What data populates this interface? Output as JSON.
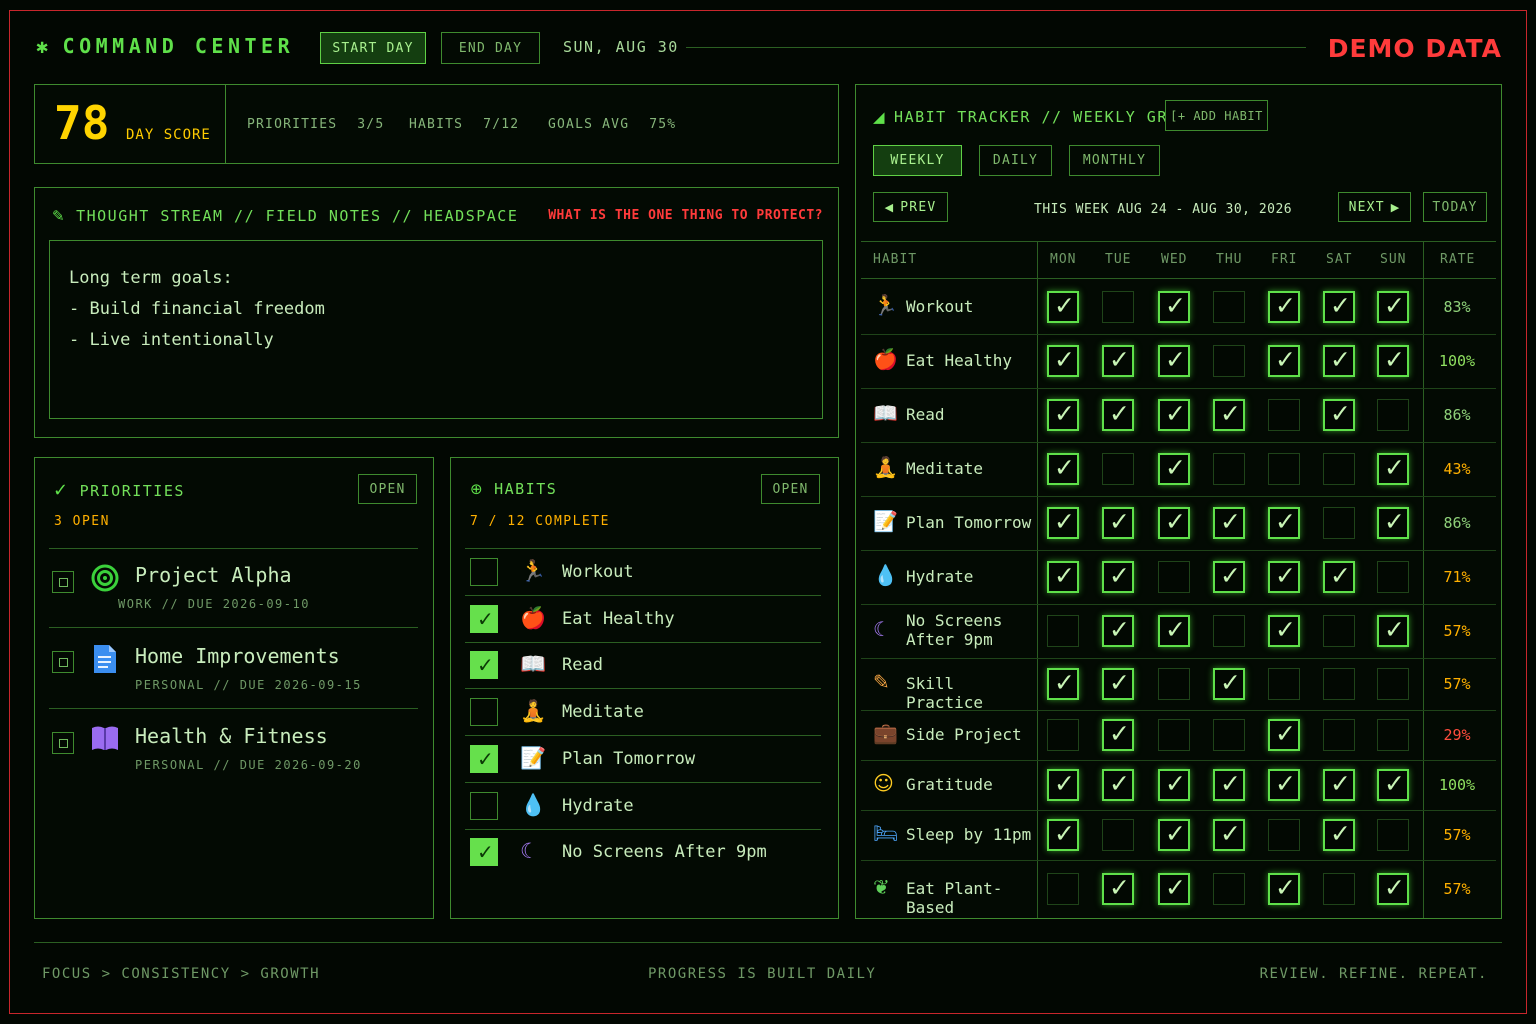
{
  "header": {
    "brand": "COMMAND CENTER",
    "start_day": "START DAY",
    "end_day": "END DAY",
    "date": "SUN, AUG 30",
    "demo": "DEMO DATA"
  },
  "score": {
    "value": "78",
    "label": "DAY SCORE",
    "stats": [
      {
        "label": "PRIORITIES",
        "value": "3/5"
      },
      {
        "label": "HABITS",
        "value": "7/12"
      },
      {
        "label": "GOALS AVG",
        "value": "75%"
      }
    ]
  },
  "thought": {
    "title": "THOUGHT STREAM // FIELD NOTES // HEADSPACE",
    "prompt": "WHAT IS THE ONE THING TO PROTECT?",
    "lines": [
      "Long term goals:",
      "- Build financial freedom",
      "- Live intentionally"
    ]
  },
  "priorities": {
    "title": "PRIORITIES",
    "open_btn": "OPEN",
    "count": "3 OPEN",
    "items": [
      {
        "title": "Project Alpha",
        "sub": "WORK // DUE 2026-09-10",
        "icon": "target-icon"
      },
      {
        "title": "Home Improvements",
        "sub": "PERSONAL // DUE 2026-09-15",
        "icon": "document-icon"
      },
      {
        "title": "Health & Fitness",
        "sub": "PERSONAL // DUE 2026-09-20",
        "icon": "book-icon"
      }
    ]
  },
  "habits": {
    "title": "HABITS",
    "open_btn": "OPEN",
    "count": "7 / 12 COMPLETE",
    "items": [
      {
        "name": "Workout",
        "checked": false
      },
      {
        "name": "Eat Healthy",
        "checked": true
      },
      {
        "name": "Read",
        "checked": true
      },
      {
        "name": "Meditate",
        "checked": false
      },
      {
        "name": "Plan Tomorrow",
        "checked": true
      },
      {
        "name": "Hydrate",
        "checked": false
      },
      {
        "name": "No Screens After 9pm",
        "checked": true
      }
    ]
  },
  "tracker": {
    "title": "HABIT TRACKER // WEEKLY GRID",
    "add_btn": "[+ ADD HABIT",
    "tabs": [
      "WEEKLY",
      "DAILY",
      "MONTHLY"
    ],
    "prev": "PREV",
    "next": "NEXT",
    "today": "TODAY",
    "week": "THIS WEEK AUG 24 - AUG 30, 2026",
    "columns": [
      "HABIT",
      "MON",
      "TUE",
      "WED",
      "THU",
      "FRI",
      "SAT",
      "SUN",
      "RATE"
    ],
    "rows": [
      {
        "name": "Workout",
        "days": [
          1,
          0,
          1,
          0,
          1,
          1,
          1
        ],
        "rate": "83%",
        "color": "#8fd17a"
      },
      {
        "name": "Eat Healthy",
        "days": [
          1,
          1,
          1,
          0,
          1,
          1,
          1
        ],
        "rate": "100%",
        "color": "#8fe060"
      },
      {
        "name": "Read",
        "days": [
          1,
          1,
          1,
          1,
          0,
          1,
          0
        ],
        "rate": "86%",
        "color": "#8fd17a"
      },
      {
        "name": "Meditate",
        "days": [
          1,
          0,
          1,
          0,
          0,
          0,
          1
        ],
        "rate": "43%",
        "color": "#ffb000"
      },
      {
        "name": "Plan Tomorrow",
        "days": [
          1,
          1,
          1,
          1,
          1,
          0,
          1
        ],
        "rate": "86%",
        "color": "#8fd17a"
      },
      {
        "name": "Hydrate",
        "days": [
          1,
          1,
          0,
          1,
          1,
          1,
          0
        ],
        "rate": "71%",
        "color": "#ffb000"
      },
      {
        "name": "No Screens After 9pm",
        "days": [
          0,
          1,
          1,
          0,
          1,
          0,
          1
        ],
        "rate": "57%",
        "color": "#ffb000"
      },
      {
        "name": "Skill Practice",
        "days": [
          1,
          1,
          0,
          1,
          0,
          0,
          0
        ],
        "rate": "57%",
        "color": "#ffb000"
      },
      {
        "name": "Side Project",
        "days": [
          0,
          1,
          0,
          0,
          1,
          0,
          0
        ],
        "rate": "29%",
        "color": "#ff4d3d"
      },
      {
        "name": "Gratitude",
        "days": [
          1,
          1,
          1,
          1,
          1,
          1,
          1
        ],
        "rate": "100%",
        "color": "#8fe060"
      },
      {
        "name": "Sleep by 11pm",
        "days": [
          1,
          0,
          1,
          1,
          0,
          1,
          0
        ],
        "rate": "57%",
        "color": "#ffb000"
      },
      {
        "name": "Eat Plant-Based",
        "days": [
          0,
          1,
          1,
          0,
          1,
          0,
          1
        ],
        "rate": "57%",
        "color": "#ffb000"
      }
    ]
  },
  "footer": {
    "left": "FOCUS > CONSISTENCY > GROWTH",
    "center": "PROGRESS IS BUILT DAILY",
    "right": "REVIEW. REFINE. REPEAT."
  }
}
